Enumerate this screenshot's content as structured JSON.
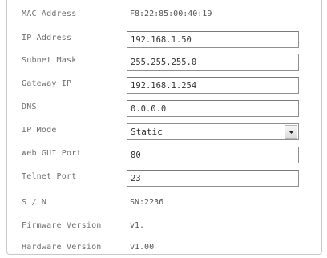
{
  "network_settings": {
    "mac_address": {
      "label": "MAC Address",
      "value": "F8:22:85:00:40:19"
    },
    "ip_address": {
      "label": "IP Address",
      "value": "192.168.1.50"
    },
    "subnet_mask": {
      "label": "Subnet Mask",
      "value": "255.255.255.0"
    },
    "gateway_ip": {
      "label": "Gateway IP",
      "value": "192.168.1.254"
    },
    "dns": {
      "label": "DNS",
      "value": "0.0.0.0"
    },
    "ip_mode": {
      "label": "IP Mode",
      "selected": "Static",
      "arrow_icon": "chevron-down-icon"
    },
    "web_gui_port": {
      "label": "Web GUI Port",
      "value": "80"
    },
    "telnet_port": {
      "label": "Telnet Port",
      "value": "23"
    },
    "serial_number": {
      "label": "S / N",
      "value": "SN:2236"
    },
    "firmware_version": {
      "label": "Firmware Version",
      "value": "v1."
    },
    "hardware_version": {
      "label": "Hardware Version",
      "value": "v1.00"
    }
  }
}
